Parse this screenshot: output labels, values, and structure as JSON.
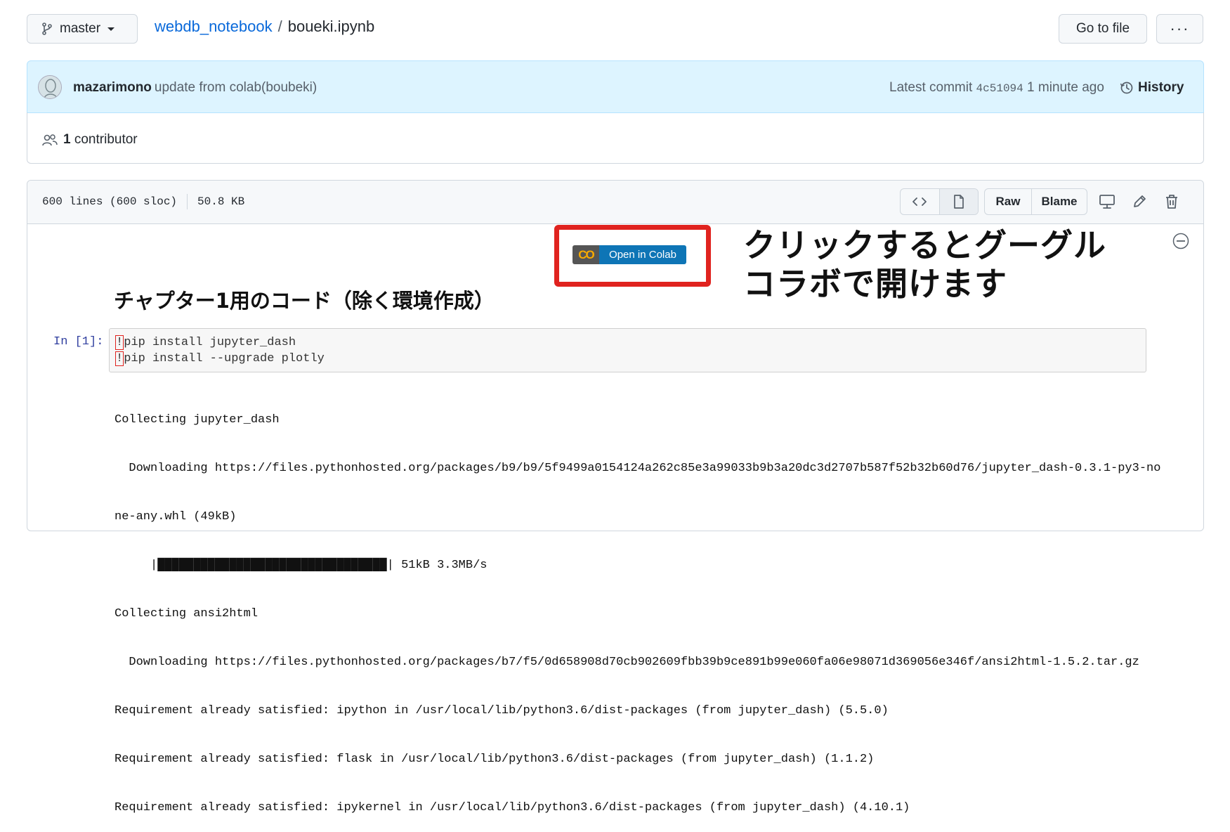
{
  "topbar": {
    "branch": "master",
    "repo": "webdb_notebook",
    "separator": "/",
    "file": "boueki.ipynb",
    "go_to_file": "Go to file",
    "more": "···"
  },
  "commit": {
    "author": "mazarimono",
    "message": "update from colab(boubeki)",
    "latest_label": "Latest commit",
    "sha": "4c51094",
    "time": "1 minute ago",
    "history": "History"
  },
  "contributors": {
    "count": "1",
    "label": "contributor"
  },
  "file_header": {
    "lines": "600 lines (600 sloc)",
    "size": "50.8 KB",
    "raw": "Raw",
    "blame": "Blame"
  },
  "notebook": {
    "colab_badge": "Open in Colab",
    "colab_logo": "CO",
    "annotation_line1": "クリックするとグーグル",
    "annotation_line2": "コラボで開けます",
    "heading": "チャプター1用のコード（除く環境作成）",
    "prompt": "In [1]:",
    "code": [
      {
        "bang": "!",
        "rest": "pip install jupyter_dash"
      },
      {
        "bang": "!",
        "rest": "pip install --upgrade plotly"
      }
    ],
    "output": [
      "Collecting jupyter_dash",
      "  Downloading https://files.pythonhosted.org/packages/b9/b9/5f9499a0154124a262c85e3a99033b9b3a20dc3d2707b587f52b32b60d76/jupyter_dash-0.3.1-py3-no",
      "ne-any.whl (49kB)",
      "     |████████████████████████████████| 51kB 3.3MB/s",
      "Collecting ansi2html",
      "  Downloading https://files.pythonhosted.org/packages/b7/f5/0d658908d70cb902609fbb39b9ce891b99e060fa06e98071d369056e346f/ansi2html-1.5.2.tar.gz",
      "Requirement already satisfied: ipython in /usr/local/lib/python3.6/dist-packages (from jupyter_dash) (5.5.0)",
      "Requirement already satisfied: flask in /usr/local/lib/python3.6/dist-packages (from jupyter_dash) (1.1.2)",
      "Requirement already satisfied: ipykernel in /usr/local/lib/python3.6/dist-packages (from jupyter_dash) (4.10.1)"
    ]
  },
  "icons": {
    "branch": "git-branch-icon",
    "history": "history-icon",
    "people": "people-icon",
    "code": "code-icon",
    "file": "file-icon",
    "desktop": "desktop-icon",
    "pencil": "pencil-icon",
    "trash": "trash-icon",
    "collapse": "collapse-icon"
  },
  "colors": {
    "link": "#0969da",
    "annotation_box": "#e0231f",
    "colab_blue": "#0e75b6",
    "colab_orange": "#f9ab00",
    "prompt": "#303f9f"
  }
}
